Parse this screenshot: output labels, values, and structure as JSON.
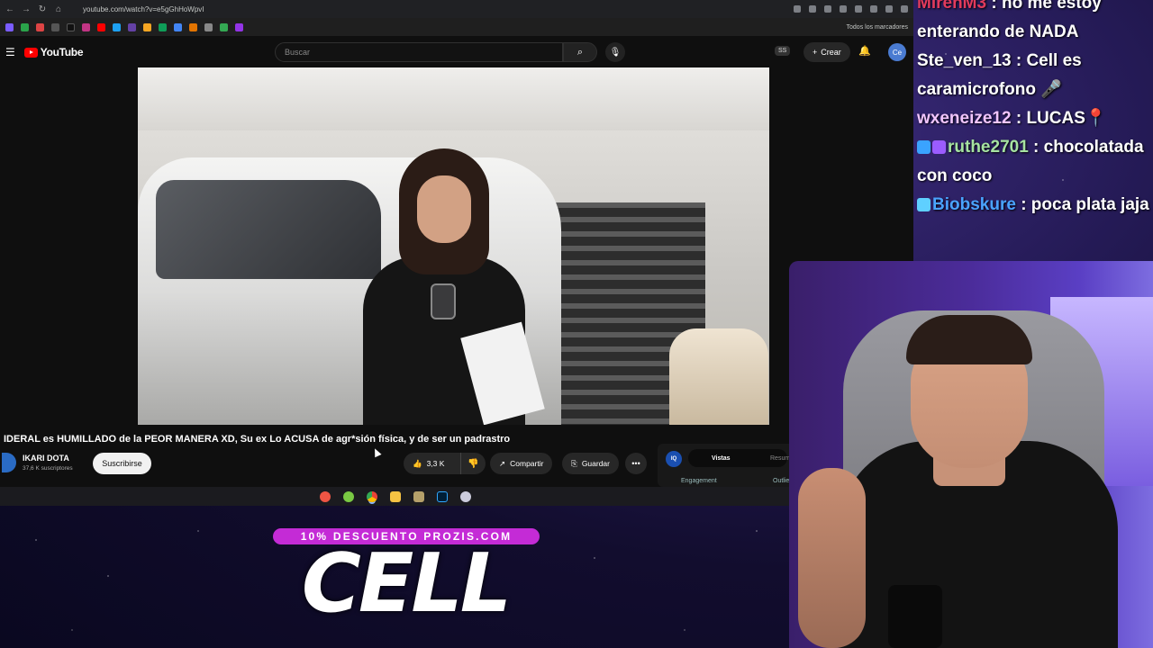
{
  "browser": {
    "url": "youtube.com/watch?v=e5gGhHoWpvI",
    "bookmarks_all_label": "Todos los marcadores"
  },
  "youtube": {
    "logo_text": "YouTube",
    "search_placeholder": "Buscar",
    "ss_badge": "SS",
    "create_label": "Crear",
    "avatar_text": "Ce"
  },
  "video": {
    "title": "IDERAL es HUMILLADO de la PEOR MANERA XD, Su ex Lo ACUSA de agr*sión física, y de ser un padrastro",
    "channel": "IKARI DOTA",
    "subscribers": "37,6 K suscriptores",
    "subscribe_label": "Suscribirse",
    "likes": "3,3 K",
    "share_label": "Compartir",
    "save_label": "Guardar"
  },
  "side_panel": {
    "logo": "IQ",
    "tab_active": "Vistas",
    "tab_other": "Resum",
    "engagement": "Engagement",
    "outliers": "Outlie"
  },
  "promo": {
    "banner": "10% DESCUENTO PROZIS.COM",
    "headline": "CELL"
  },
  "chat": {
    "messages": [
      {
        "user": "MirenM3",
        "text": ": no me estoy enterando de NADA",
        "color": "#e23b5c"
      },
      {
        "user": "Ste_ven_13",
        "text": ": Cell es caramicrofono 🎤",
        "color": "#ffffff"
      },
      {
        "user": "wxeneize12",
        "text": ": LUCAS📍",
        "color": "#f2c6ff"
      },
      {
        "user": "ruthe2701",
        "text": ": chocolatada con coco",
        "color": "#a6e3a1"
      },
      {
        "user": "Biobskure",
        "text": ": poca plata jaja",
        "color": "#4aa3ff"
      }
    ]
  },
  "colors": {
    "yt_red": "#ff0000",
    "promo_pink": "#c42bd6",
    "stream_bg": "#241a55"
  }
}
